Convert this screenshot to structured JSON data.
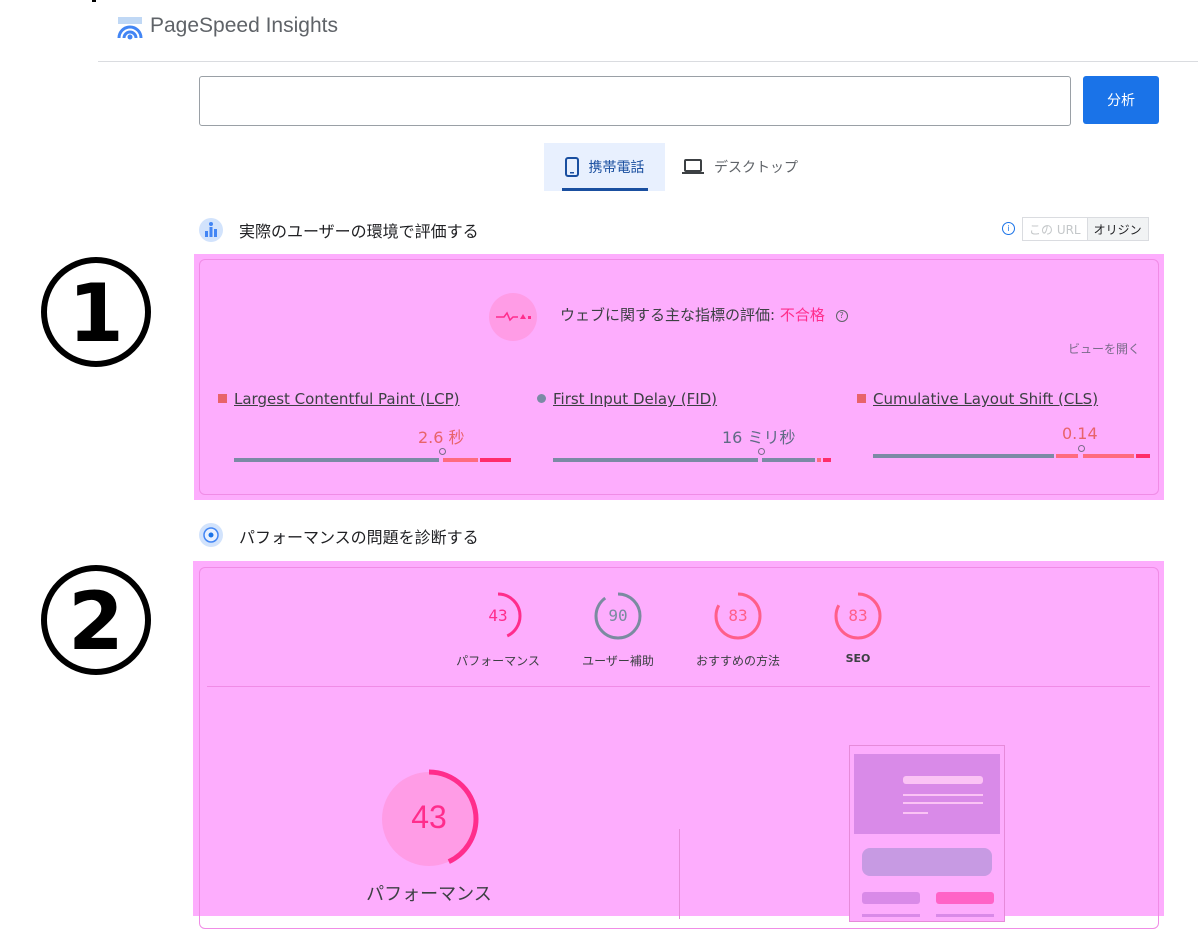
{
  "app": {
    "title": "PageSpeed Insights"
  },
  "search": {
    "value": "",
    "placeholder": "",
    "analyze_label": "分析"
  },
  "tabs": [
    {
      "label": "携帯電話",
      "active": true
    },
    {
      "label": "デスクトップ",
      "active": false
    }
  ],
  "field": {
    "heading": "実際のユーザーの環境で評価する",
    "toggle": {
      "this_url": "この URL",
      "origin": "オリジン",
      "selected": "オリジン"
    },
    "cwv_label": "ウェブに関する主な指標の評価: ",
    "cwv_status": "不合格",
    "expand_view": "ビューを開く",
    "metrics": [
      {
        "name": "Largest Contentful Paint (LCP)",
        "value": "2.6 秒",
        "color": "#e8636a",
        "marker": "square"
      },
      {
        "name": "First Input Delay (FID)",
        "value": "16 ミリ秒",
        "color": "#7b8aa5",
        "marker": "circle"
      },
      {
        "name": "Cumulative Layout Shift (CLS)",
        "value": "0.14",
        "color": "#e8636a",
        "marker": "square"
      }
    ]
  },
  "annotations": {
    "one": "①",
    "two": "②"
  },
  "lab": {
    "heading": "パフォーマンスの問題を診断する",
    "gauges": [
      {
        "score": "43",
        "label": "パフォーマンス",
        "fill": 0.43,
        "color": "#ff2d8c"
      },
      {
        "score": "90",
        "label": "ユーザー補助",
        "fill": 0.9,
        "color": "#7a8ba0"
      },
      {
        "score": "83",
        "label": "おすすめの方法",
        "fill": 0.83,
        "color": "#ff5e8a"
      },
      {
        "score": "83",
        "label": "SEO",
        "fill": 0.83,
        "color": "#ff5e8a"
      }
    ],
    "main_score": "43",
    "main_label": "パフォーマンス",
    "main_fill": 0.43
  },
  "colors": {
    "accent": "#1a73e8",
    "highlight": "#fdadfd",
    "fail": "#ff2d8c"
  }
}
